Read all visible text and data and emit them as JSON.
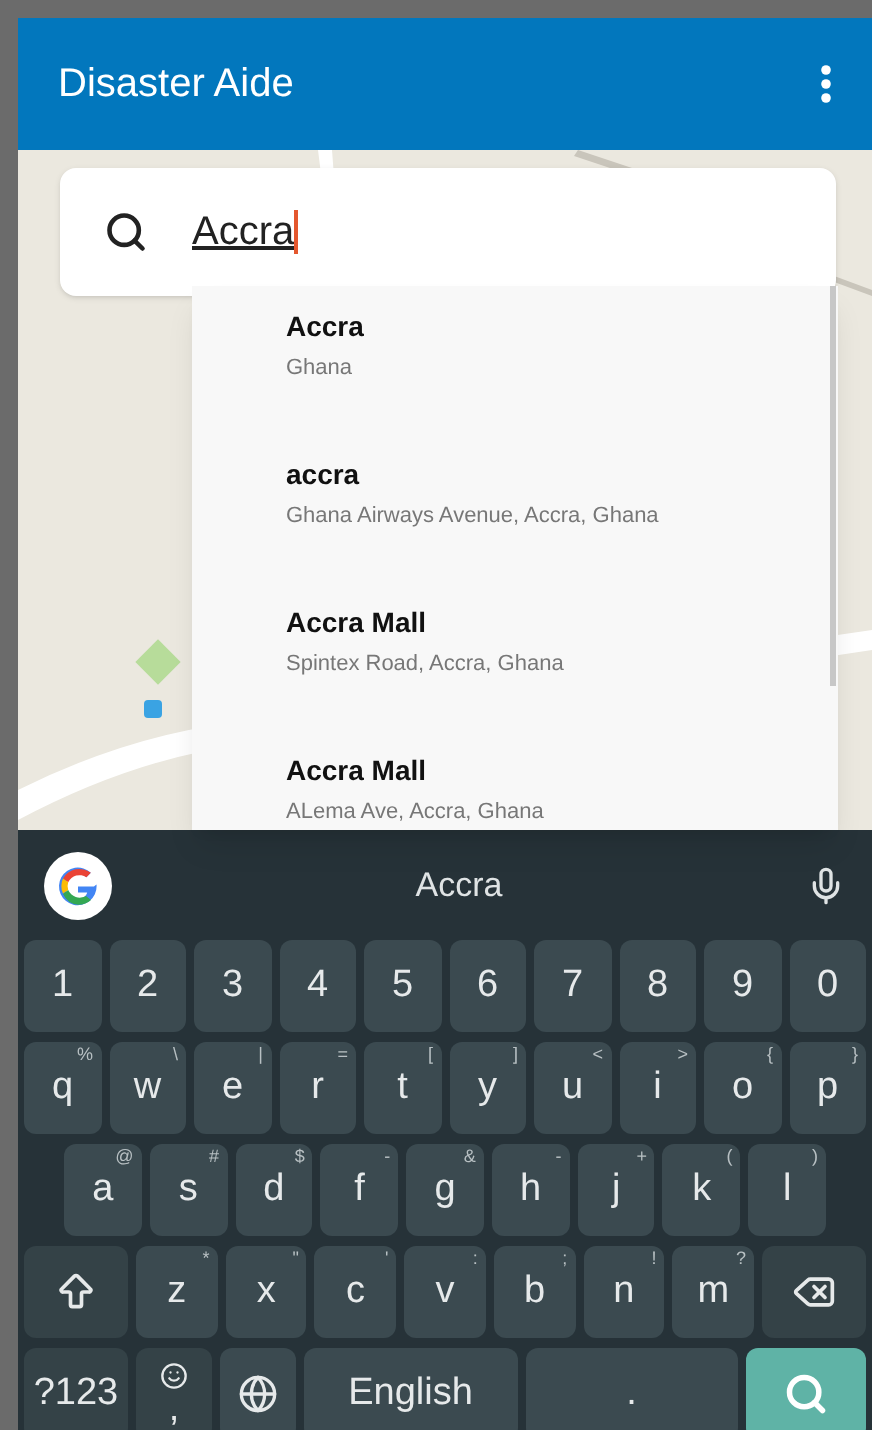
{
  "app_bar": {
    "title": "Disaster Aide"
  },
  "search": {
    "value": "Accra"
  },
  "suggestions": [
    {
      "title": "Accra",
      "subtitle": "Ghana"
    },
    {
      "title": "accra",
      "subtitle": "Ghana Airways Avenue, Accra, Ghana"
    },
    {
      "title": "Accra Mall",
      "subtitle": "Spintex Road, Accra, Ghana"
    },
    {
      "title": "Accra Mall",
      "subtitle": "ALema Ave, Accra, Ghana"
    }
  ],
  "keyboard": {
    "suggestion": "Accra",
    "rows": [
      [
        {
          "kind": "key",
          "label": "1"
        },
        {
          "kind": "key",
          "label": "2"
        },
        {
          "kind": "key",
          "label": "3"
        },
        {
          "kind": "key",
          "label": "4"
        },
        {
          "kind": "key",
          "label": "5"
        },
        {
          "kind": "key",
          "label": "6"
        },
        {
          "kind": "key",
          "label": "7"
        },
        {
          "kind": "key",
          "label": "8"
        },
        {
          "kind": "key",
          "label": "9"
        },
        {
          "kind": "key",
          "label": "0"
        }
      ],
      [
        {
          "kind": "key",
          "label": "q",
          "hint": "%"
        },
        {
          "kind": "key",
          "label": "w",
          "hint": "\\"
        },
        {
          "kind": "key",
          "label": "e",
          "hint": "|"
        },
        {
          "kind": "key",
          "label": "r",
          "hint": "="
        },
        {
          "kind": "key",
          "label": "t",
          "hint": "["
        },
        {
          "kind": "key",
          "label": "y",
          "hint": "]"
        },
        {
          "kind": "key",
          "label": "u",
          "hint": "<"
        },
        {
          "kind": "key",
          "label": "i",
          "hint": ">"
        },
        {
          "kind": "key",
          "label": "o",
          "hint": "{"
        },
        {
          "kind": "key",
          "label": "p",
          "hint": "}"
        }
      ],
      [
        {
          "kind": "key",
          "label": "a",
          "hint": "@"
        },
        {
          "kind": "key",
          "label": "s",
          "hint": "#"
        },
        {
          "kind": "key",
          "label": "d",
          "hint": "$"
        },
        {
          "kind": "key",
          "label": "f",
          "hint": "-"
        },
        {
          "kind": "key",
          "label": "g",
          "hint": "&"
        },
        {
          "kind": "key",
          "label": "h",
          "hint": "-"
        },
        {
          "kind": "key",
          "label": "j",
          "hint": "+"
        },
        {
          "kind": "key",
          "label": "k",
          "hint": "("
        },
        {
          "kind": "key",
          "label": "l",
          "hint": ")"
        }
      ],
      [
        {
          "kind": "shift"
        },
        {
          "kind": "key",
          "label": "z",
          "hint": "*"
        },
        {
          "kind": "key",
          "label": "x",
          "hint": "\""
        },
        {
          "kind": "key",
          "label": "c",
          "hint": "'"
        },
        {
          "kind": "key",
          "label": "v",
          "hint": ":"
        },
        {
          "kind": "key",
          "label": "b",
          "hint": ";"
        },
        {
          "kind": "key",
          "label": "n",
          "hint": "!"
        },
        {
          "kind": "key",
          "label": "m",
          "hint": "?"
        },
        {
          "kind": "backspace"
        }
      ],
      [
        {
          "kind": "symbols",
          "label": "?123"
        },
        {
          "kind": "emoji",
          "label": ","
        },
        {
          "kind": "globe"
        },
        {
          "kind": "space",
          "label": "English"
        },
        {
          "kind": "key",
          "label": "."
        },
        {
          "kind": "enter"
        }
      ]
    ]
  }
}
